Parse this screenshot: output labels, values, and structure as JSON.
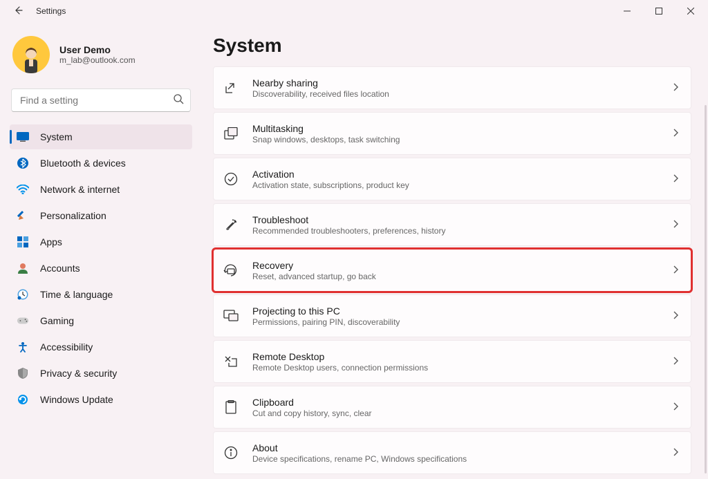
{
  "window": {
    "title": "Settings"
  },
  "profile": {
    "name": "User Demo",
    "email": "m_lab@outlook.com"
  },
  "search": {
    "placeholder": "Find a setting"
  },
  "nav": {
    "items": [
      {
        "label": "System",
        "icon": "system",
        "active": true
      },
      {
        "label": "Bluetooth & devices",
        "icon": "bluetooth"
      },
      {
        "label": "Network & internet",
        "icon": "network"
      },
      {
        "label": "Personalization",
        "icon": "personalization"
      },
      {
        "label": "Apps",
        "icon": "apps"
      },
      {
        "label": "Accounts",
        "icon": "accounts"
      },
      {
        "label": "Time & language",
        "icon": "time"
      },
      {
        "label": "Gaming",
        "icon": "gaming"
      },
      {
        "label": "Accessibility",
        "icon": "accessibility"
      },
      {
        "label": "Privacy & security",
        "icon": "privacy"
      },
      {
        "label": "Windows Update",
        "icon": "update"
      }
    ]
  },
  "page": {
    "title": "System",
    "cards": [
      {
        "title": "Nearby sharing",
        "sub": "Discoverability, received files location",
        "icon": "share"
      },
      {
        "title": "Multitasking",
        "sub": "Snap windows, desktops, task switching",
        "icon": "multitask"
      },
      {
        "title": "Activation",
        "sub": "Activation state, subscriptions, product key",
        "icon": "activation"
      },
      {
        "title": "Troubleshoot",
        "sub": "Recommended troubleshooters, preferences, history",
        "icon": "troubleshoot"
      },
      {
        "title": "Recovery",
        "sub": "Reset, advanced startup, go back",
        "icon": "recovery",
        "highlighted": true
      },
      {
        "title": "Projecting to this PC",
        "sub": "Permissions, pairing PIN, discoverability",
        "icon": "project"
      },
      {
        "title": "Remote Desktop",
        "sub": "Remote Desktop users, connection permissions",
        "icon": "remote"
      },
      {
        "title": "Clipboard",
        "sub": "Cut and copy history, sync, clear",
        "icon": "clipboard"
      },
      {
        "title": "About",
        "sub": "Device specifications, rename PC, Windows specifications",
        "icon": "about"
      }
    ]
  }
}
